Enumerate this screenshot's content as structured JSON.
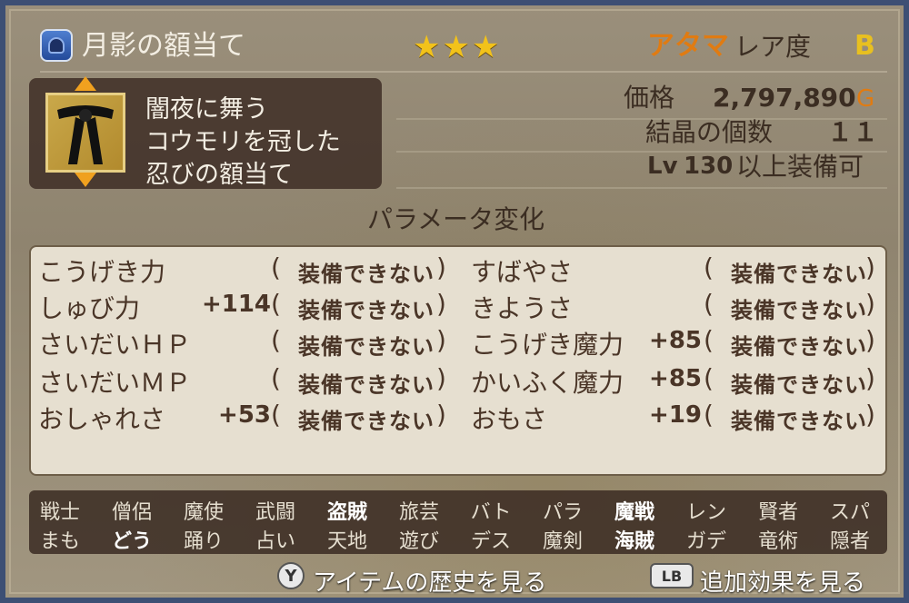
{
  "item": {
    "name": "月影の額当て",
    "stars": "★★★",
    "slot": "アタマ",
    "rarity_label": "レア度",
    "rarity": "B",
    "description": [
      "闇夜に舞う",
      "コウモリを冠した",
      "忍びの額当て"
    ],
    "price_label": "価格",
    "price": "2,797,890",
    "price_unit": "G",
    "crystal_label": "結晶の個数",
    "crystal_count": "１１",
    "lv_prefix": "Lv",
    "lv_value": "130",
    "lv_suffix": "以上装備可"
  },
  "params": {
    "title": "パラメータ変化",
    "cannot_equip": "装備できない",
    "left": [
      {
        "name": "こうげき力",
        "value": ""
      },
      {
        "name": "しゅび力",
        "value": "+114"
      },
      {
        "name": "さいだいＨＰ",
        "value": ""
      },
      {
        "name": "さいだいＭＰ",
        "value": ""
      },
      {
        "name": "おしゃれさ",
        "value": "+53"
      }
    ],
    "right": [
      {
        "name": "すばやさ",
        "value": ""
      },
      {
        "name": "きようさ",
        "value": ""
      },
      {
        "name": "こうげき魔力",
        "value": "+85"
      },
      {
        "name": "かいふく魔力",
        "value": "+85"
      },
      {
        "name": "おもさ",
        "value": "+19"
      }
    ]
  },
  "jobs": {
    "row1": [
      "戦士",
      "僧侶",
      "魔使",
      "武闘",
      "盗賊",
      "旅芸",
      "バト",
      "パラ",
      "魔戦",
      "レン",
      "賢者",
      "スパ"
    ],
    "row2": [
      "まも",
      "どう",
      "踊り",
      "占い",
      "天地",
      "遊び",
      "デス",
      "魔剣",
      "海賊",
      "ガデ",
      "竜術",
      "隠者"
    ]
  },
  "footer": {
    "y_button": "Y",
    "history_label": "アイテムの歴史を見る",
    "lb_button": "LB",
    "extra_effects_label": "追加効果を見る"
  },
  "colors": {
    "stars": "#f2c21a",
    "slot": "#e07b12",
    "rarity": "#e8c020",
    "icon_bg": "#2f5fb8"
  },
  "icons": {
    "equip_type": "helmet-icon",
    "item": "headband-icon"
  }
}
